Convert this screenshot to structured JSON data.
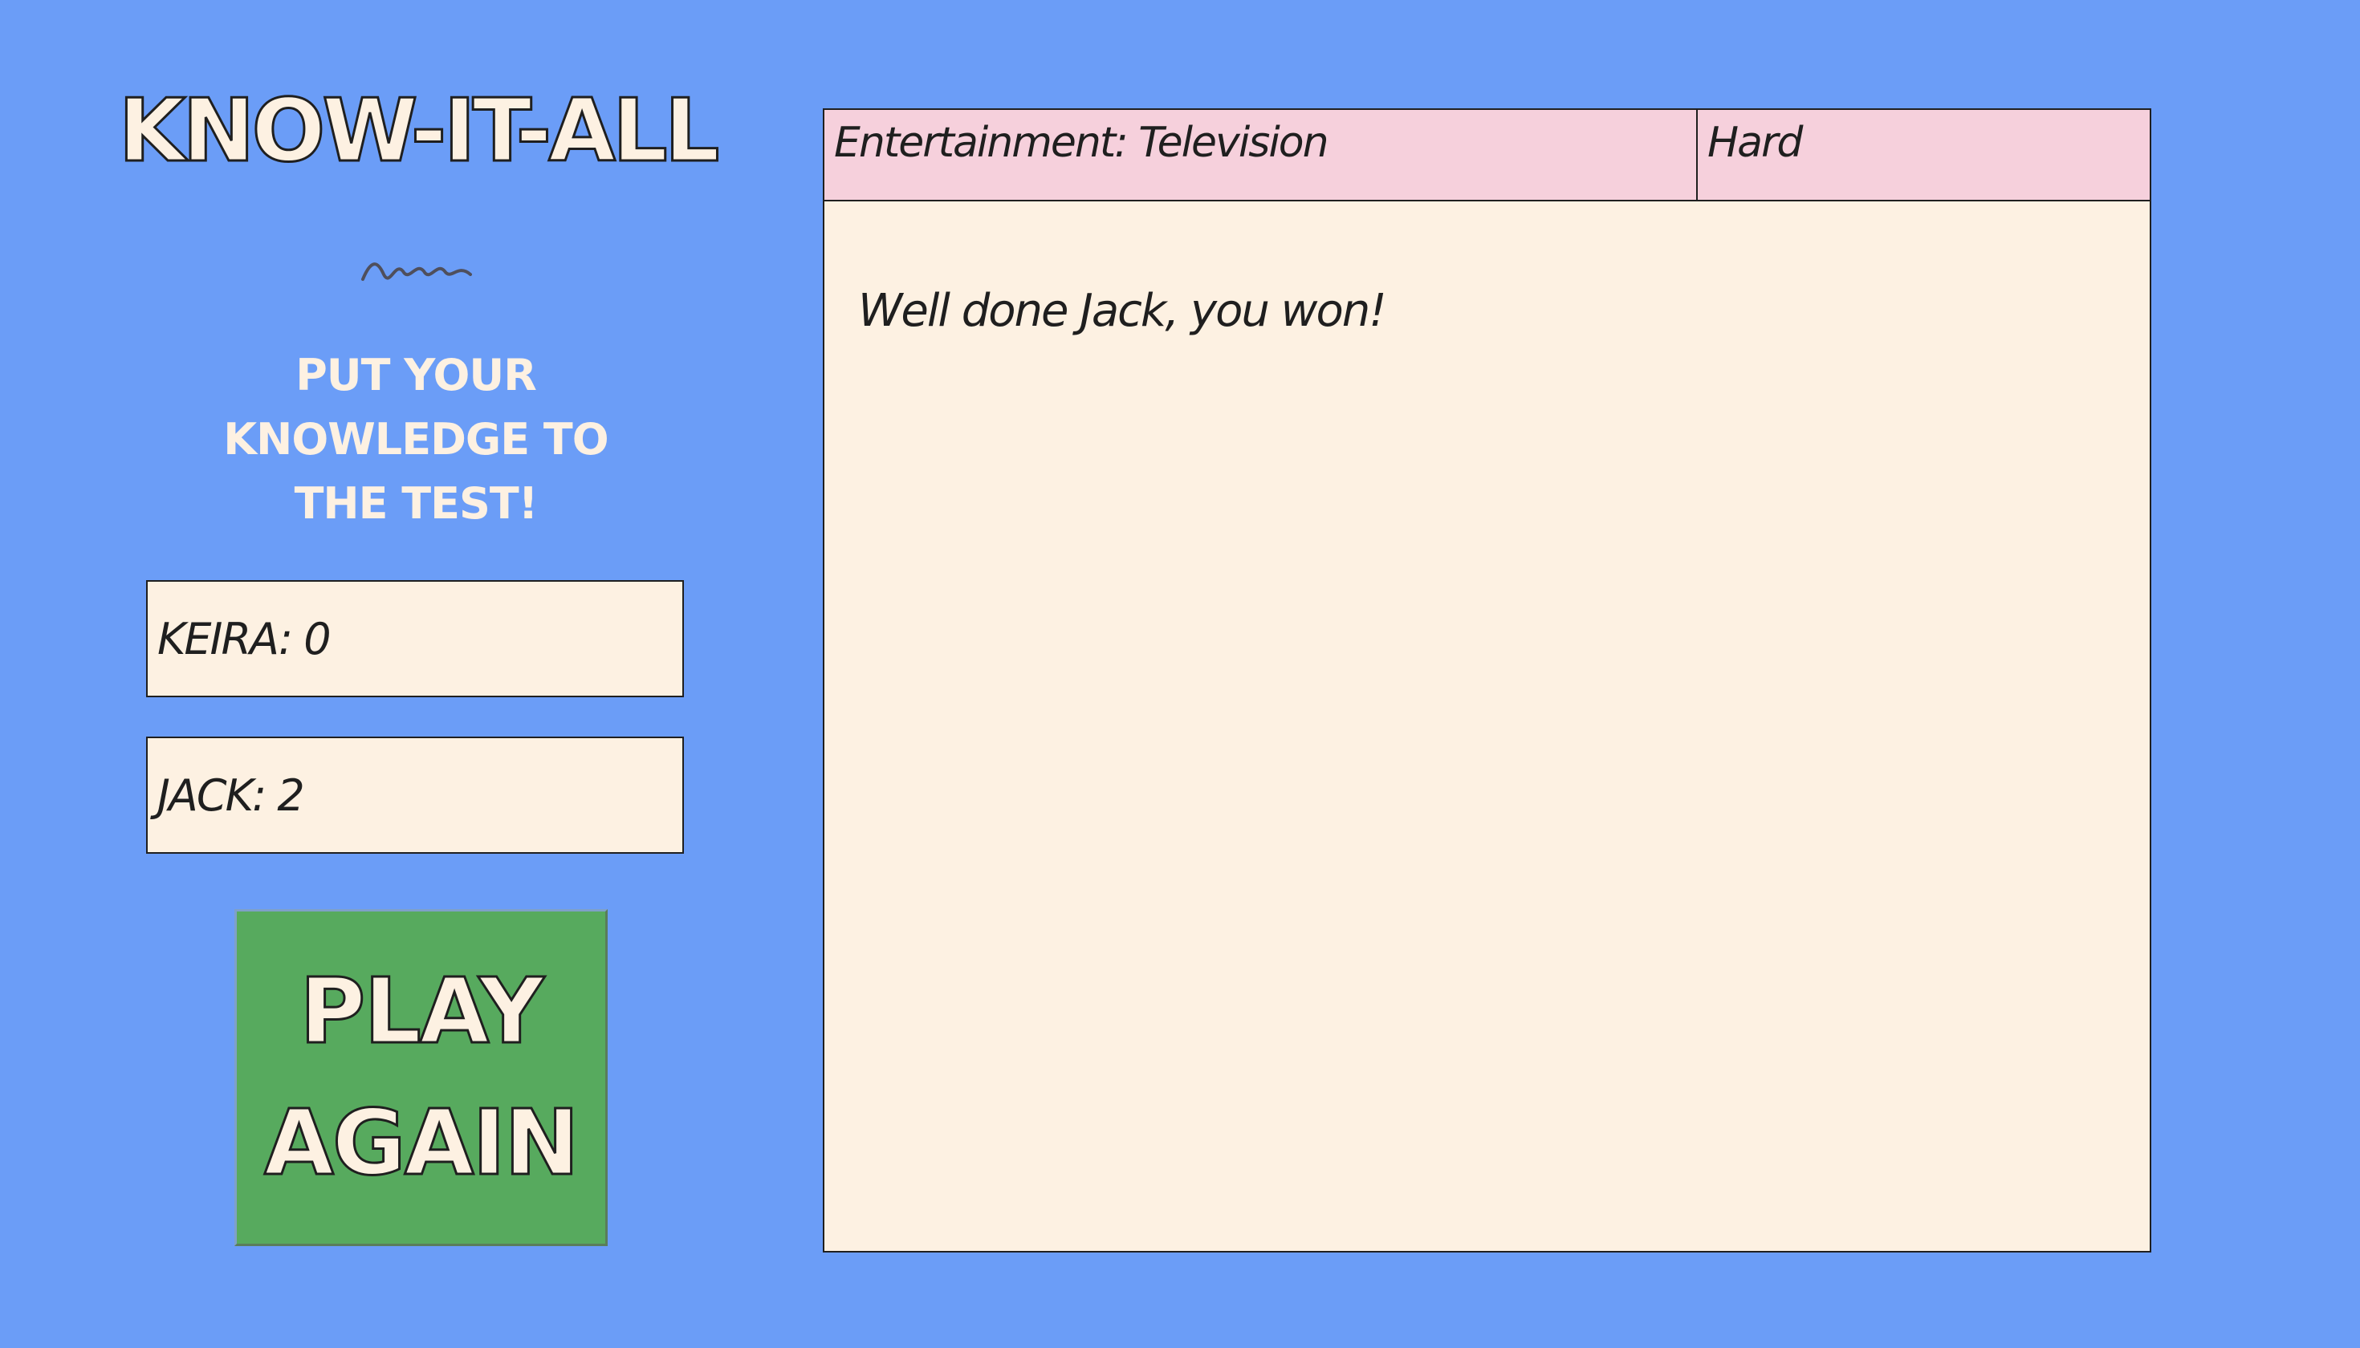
{
  "app": {
    "title": "KNOW-IT-ALL",
    "tagline_lines": [
      "PUT YOUR",
      "KNOWLEDGE TO",
      "THE TEST!"
    ],
    "decoration_icon": "squiggle-icon"
  },
  "scores": [
    {
      "label": "KEIRA: 0"
    },
    {
      "label": "JACK: 2"
    }
  ],
  "play_button": {
    "lines": [
      "PLAY",
      "AGAIN"
    ]
  },
  "question_panel": {
    "category": "Entertainment: Television",
    "difficulty": "Hard",
    "message": "Well done Jack, you won!"
  },
  "colors": {
    "background": "#6b9df7",
    "cream": "#fdf1e2",
    "header_pink": "#f6d0dc",
    "button_green": "#57aa5e",
    "outline": "#1f1f1f"
  }
}
